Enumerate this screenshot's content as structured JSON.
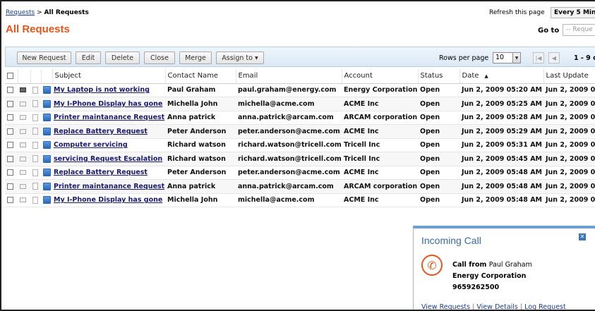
{
  "breadcrumb": {
    "root": "Requests",
    "separator": ">",
    "current": "All Requests"
  },
  "refresh": {
    "label": "Refresh this page",
    "value": "Every 5 Minu"
  },
  "page_title": "All Requests",
  "goto": {
    "label": "Go to",
    "placeholder": "-- Reque"
  },
  "toolbar": {
    "new_request": "New Request",
    "edit": "Edit",
    "delete": "Delete",
    "close": "Close",
    "merge": "Merge",
    "assign_to": "Assign to ▾",
    "rows_label": "Rows per page",
    "rows_value": "10",
    "page_range": "1 - 9 o"
  },
  "columns": [
    "Subject",
    "Contact Name",
    "Email",
    "Account",
    "Status",
    "Date",
    "Last Update"
  ],
  "rows": [
    {
      "subject": "My Laptop is not working",
      "contact": "Paul Graham",
      "email": "paul.graham@energy.com",
      "account": "Energy Corporation",
      "status": "Open",
      "date": "Jun 2, 2009 05:20 AM",
      "updated": "Jun 2, 2009 0"
    },
    {
      "subject": "My I-Phone Display has gone",
      "contact": "Michella John",
      "email": "michella@acme.com",
      "account": "ACME Inc",
      "status": "Open",
      "date": "Jun 2, 2009 05:25 AM",
      "updated": "Jun 2, 2009 0"
    },
    {
      "subject": "Printer maintanance Request",
      "contact": "Anna patrick",
      "email": "anna.patrick@arcam.com",
      "account": "ARCAM corporation",
      "status": "Open",
      "date": "Jun 2, 2009 05:28 AM",
      "updated": "Jun 2, 2009 0"
    },
    {
      "subject": "Replace Battery Request",
      "contact": "Peter Anderson",
      "email": "peter.anderson@acme.com",
      "account": "ACME Inc",
      "status": "Open",
      "date": "Jun 2, 2009 05:29 AM",
      "updated": "Jun 2, 2009 0"
    },
    {
      "subject": "Computer servicing",
      "contact": "Richard watson",
      "email": "richard.watson@tricell.com",
      "account": "Tricell Inc",
      "status": "Open",
      "date": "Jun 2, 2009 05:31 AM",
      "updated": "Jun 2, 2009 0"
    },
    {
      "subject": "servicing Request Escalation",
      "contact": "Richard watson",
      "email": "richard.watson@tricell.com",
      "account": "Tricell Inc",
      "status": "Open",
      "date": "Jun 2, 2009 05:45 AM",
      "updated": "Jun 2, 2009 0"
    },
    {
      "subject": "Replace Battery Request",
      "contact": "Peter Anderson",
      "email": "peter.anderson@acme.com",
      "account": "ACME Inc",
      "status": "Open",
      "date": "Jun 2, 2009 05:48 AM",
      "updated": "Jun 2, 2009 0"
    },
    {
      "subject": "Printer maintanance Request",
      "contact": "Anna patrick",
      "email": "anna.patrick@arcam.com",
      "account": "ARCAM corporation",
      "status": "Open",
      "date": "Jun 2, 2009 05:48 AM",
      "updated": "Jun 2, 2009 0"
    },
    {
      "subject": "My I-Phone Display has gone",
      "contact": "Michella John",
      "email": "michella@acme.com",
      "account": "ACME Inc",
      "status": "Open",
      "date": "Jun 2, 2009 05:48 AM",
      "updated": "Jun 2, 2009 0"
    }
  ],
  "popup": {
    "title": "Incoming Call",
    "call_from_label": "Call from",
    "caller": "Paul Graham",
    "company": "Energy Corporation",
    "phone": "9659262500",
    "link_view_requests": "View Requests",
    "link_view_details": "View Details",
    "link_log_request": "Log Request",
    "link_separator": "|"
  },
  "colors": {
    "accent": "#e8551a",
    "link": "#1a3d8f",
    "toolbar": "#dbe9f5"
  }
}
